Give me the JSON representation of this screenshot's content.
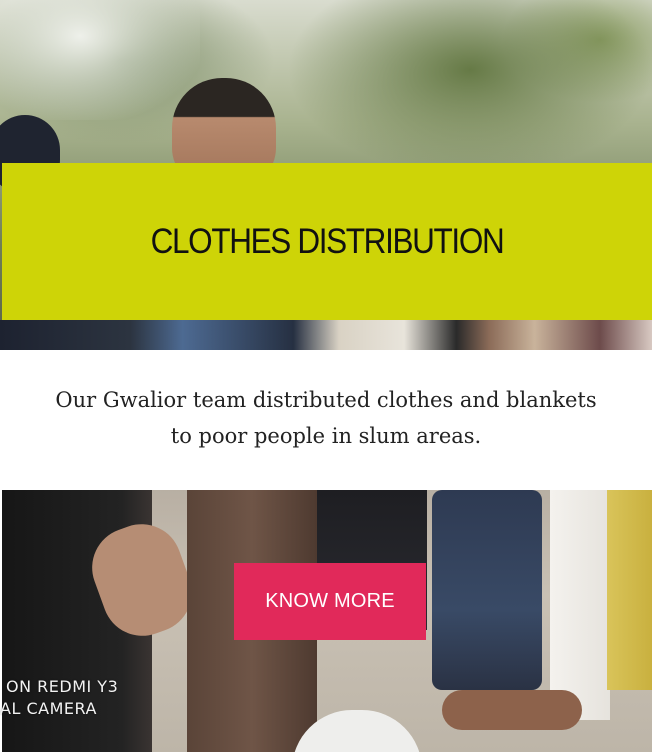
{
  "section": {
    "title": "CLOTHES DISTRIBUTION",
    "description_line1": "Our Gwalior team distributed clothes and blankets",
    "description_line2": "to poor people in slum areas.",
    "cta_label": "KNOW MORE"
  },
  "photo_watermark": {
    "line1": "ON REDMI Y3",
    "line2": "AL CAMERA"
  },
  "colors": {
    "banner": "#ced407",
    "cta": "#e1295a",
    "text": "#222222"
  }
}
